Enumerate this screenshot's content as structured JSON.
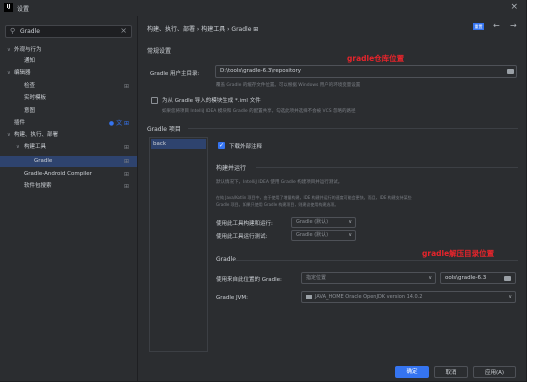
{
  "window": {
    "app_icon": "IJ",
    "title": "设置",
    "close_icon": "close-icon"
  },
  "search": {
    "value": "Gradle",
    "placeholder": "",
    "icon": "search-icon",
    "clear": "×"
  },
  "tree": [
    {
      "label": "外观与行为",
      "arrow": "∨"
    },
    {
      "label": "通知"
    },
    {
      "label": "编辑器",
      "arrow": "∨"
    },
    {
      "label": "检查",
      "rhs": "⊞"
    },
    {
      "label": "实时模板"
    },
    {
      "label": "意图"
    },
    {
      "label": "插件",
      "rhs": "● 文 ⊞"
    },
    {
      "label": "构建、执行、部署",
      "arrow": "∨"
    },
    {
      "label": "构建工具",
      "arrow": "∨",
      "rhs": "⊞"
    },
    {
      "label": "Gradle",
      "rhs": "⊞"
    },
    {
      "label": "Gradle-Android Compiler",
      "rhs": "⊞"
    },
    {
      "label": "软件包搜索",
      "rhs": "⊞"
    }
  ],
  "breadcrumb": "构建、执行、部署  ›  构建工具  ›  Gradle  ⊞",
  "header": {
    "reset": "重置",
    "back": "←",
    "forward": "→"
  },
  "general": {
    "title": "常规设置",
    "user_home_label": "Gradle 用户主目录:",
    "user_home_value": "D:\\tools\\gradle-6.3\\repository",
    "user_home_hint": "覆盖 Gradle 的缓存文件位置。可以根据 Windows 用户的环境变量设置",
    "iml_label": "为从 Gradle 导入的模块生成 *.iml 文件",
    "iml_hint": "如果您将项目 IntelliJ IDEA 模块和 Gradle 的配置共享，勾选此项并选择不会被 VCS 忽略的路径"
  },
  "projects": {
    "title": "Gradle 项目",
    "items": [
      "back"
    ]
  },
  "project_settings": {
    "download_label": "下载外部注释",
    "build_run_title": "构建并运行",
    "build_run_hint1": "默认情况下，IntelliJ IDEA 使用 Gradle 构建项目并运行测试。",
    "build_run_hint2": "在纯 Java/Kotlin 项目中，由于使用了增量构建，IDE 构建并运行的速度可能会更快。而且，IDE 构建支持某些",
    "build_run_hint3": "Gradle 项目。如果只使用 Gradle 构建项目，则建议使用构建选项。",
    "build_with_label": "使用此工具构建和运行:",
    "build_with_value": "Gradle (默认)",
    "test_with_label": "使用此工具运行测试:",
    "test_with_value": "Gradle (默认)",
    "gradle_title": "Gradle",
    "gradle_from_label": "使用来自此位置的 Gradle:",
    "gradle_from_value": "指定位置",
    "gradle_path_value": "ools\\gradle-6.3",
    "jvm_label": "Gradle JVM:",
    "jvm_value": "JAVA_HOME  Oracle OpenJDK version 14.0.2"
  },
  "annotations": {
    "top": "gradle仓库位置",
    "bottom": "gradle解压目录位置",
    "color": "#e8242b"
  },
  "footer": {
    "help": "?",
    "ok": "确定",
    "cancel": "取消",
    "apply": "应用(A)"
  },
  "colors": {
    "background": "#2b2d30",
    "selection": "#2e436e",
    "accent": "#3574f0"
  }
}
